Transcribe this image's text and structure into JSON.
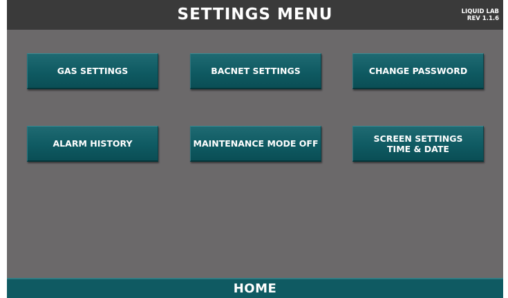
{
  "header": {
    "title": "SETTINGS MENU",
    "meta_line1": "LIQUID LAB",
    "meta_line2": "REV 1.1.6"
  },
  "buttons": {
    "gas_settings": "GAS SETTINGS",
    "bacnet_settings": "BACNET SETTINGS",
    "change_password": "CHANGE PASSWORD",
    "alarm_history": "ALARM HISTORY",
    "maintenance_mode": "MAINTENANCE MODE OFF",
    "screen_settings": "SCREEN SETTINGS\nTIME & DATE"
  },
  "footer": {
    "home_label": "HOME"
  },
  "colors": {
    "background": "#6b696a",
    "header": "#3a3a3a",
    "button": "#0f5a62",
    "text": "#ffffff"
  }
}
